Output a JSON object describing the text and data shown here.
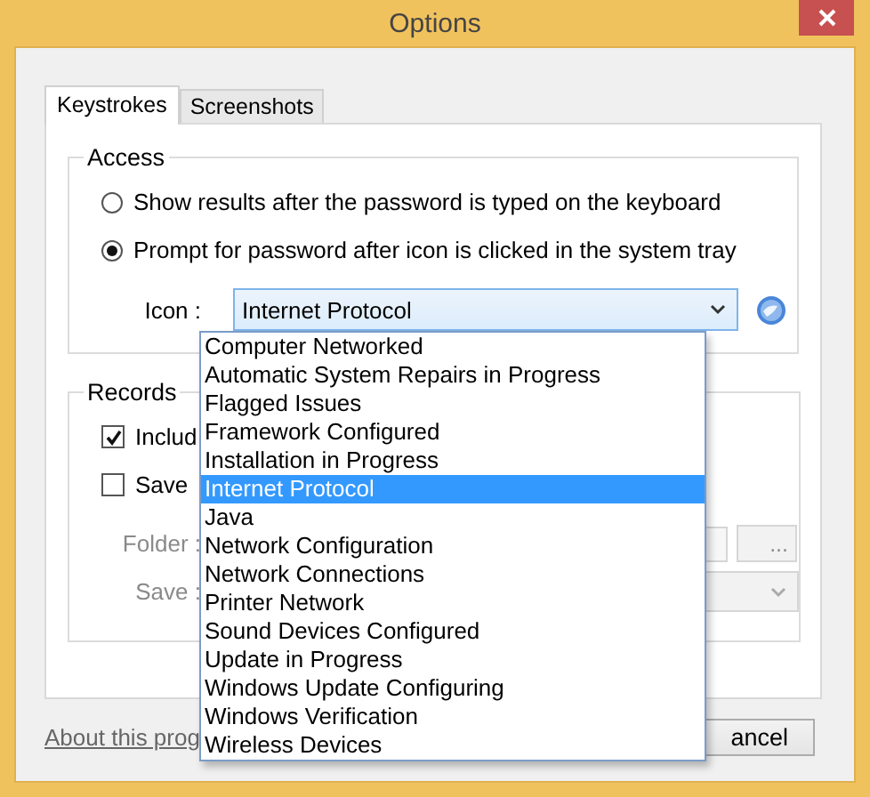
{
  "window": {
    "title": "Options"
  },
  "tabs": [
    {
      "label": "Keystrokes",
      "selected": true
    },
    {
      "label": "Screenshots",
      "selected": false
    }
  ],
  "access": {
    "title": "Access",
    "options": [
      {
        "label": "Show results after the password is typed on the keyboard",
        "selected": false
      },
      {
        "label": "Prompt for password after icon is clicked in the system tray",
        "selected": true
      }
    ],
    "icon_label": "Icon :",
    "icon_value": "Internet Protocol"
  },
  "icon_dropdown": {
    "items": [
      {
        "label": "Computer Networked",
        "selected": false
      },
      {
        "label": "Automatic System Repairs in Progress",
        "selected": false
      },
      {
        "label": "Flagged Issues",
        "selected": false
      },
      {
        "label": "Framework Configured",
        "selected": false
      },
      {
        "label": "Installation in Progress",
        "selected": false
      },
      {
        "label": "Internet Protocol",
        "selected": true
      },
      {
        "label": "Java",
        "selected": false
      },
      {
        "label": "Network Configuration",
        "selected": false
      },
      {
        "label": "Network Connections",
        "selected": false
      },
      {
        "label": "Printer Network",
        "selected": false
      },
      {
        "label": "Sound Devices Configured",
        "selected": false
      },
      {
        "label": "Update in Progress",
        "selected": false
      },
      {
        "label": "Windows Update Configuring",
        "selected": false
      },
      {
        "label": "Windows Verification",
        "selected": false
      },
      {
        "label": "Wireless Devices",
        "selected": false
      }
    ]
  },
  "records": {
    "title": "Records",
    "checkboxes": [
      {
        "label": "Includ",
        "checked": true
      },
      {
        "label": "Save",
        "checked": false
      }
    ],
    "folder_label": "Folder :",
    "folder_button": "...",
    "save_label": "Save :",
    "disabled": true
  },
  "footer": {
    "link": "About this prog",
    "button": "ancel"
  }
}
